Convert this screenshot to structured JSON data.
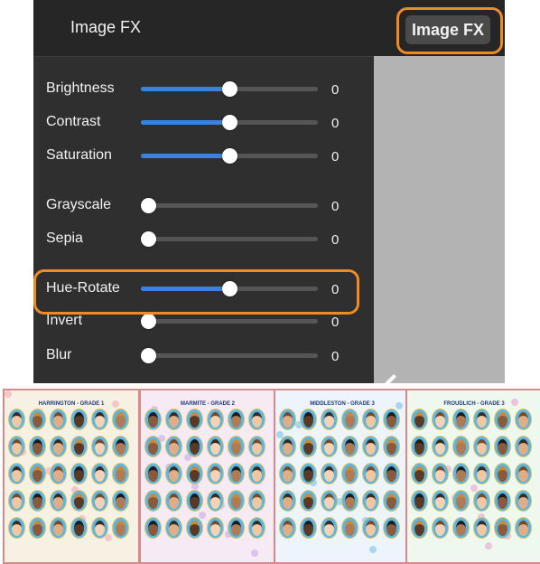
{
  "panel": {
    "title": "Image FX"
  },
  "toolbar": {
    "image_fx_button_label": "Image FX"
  },
  "sliders": [
    {
      "label": "Brightness",
      "value": "0",
      "level": 0.5
    },
    {
      "label": "Contrast",
      "value": "0",
      "level": 0.5
    },
    {
      "label": "Saturation",
      "value": "0",
      "level": 0.5
    },
    {
      "label": "Grayscale",
      "value": "0",
      "level": 0.0
    },
    {
      "label": "Sepia",
      "value": "0",
      "level": 0.0
    },
    {
      "label": "Hue-Rotate",
      "value": "0",
      "level": 0.5
    },
    {
      "label": "Invert",
      "value": "0",
      "level": 0.0
    },
    {
      "label": "Blur",
      "value": "0",
      "level": 0.0
    }
  ],
  "posters": [
    {
      "title": "HARRINGTON - GRADE 1",
      "bg": "#f7f1e3",
      "ring": "#58b7e6",
      "flower": "#f2a3b7"
    },
    {
      "title": "MARMITE - GRADE 2",
      "bg": "#f6ebf4",
      "ring": "#58b7e6",
      "flower": "#c6a2e8"
    },
    {
      "title": "MIDDLESTON - GRADE 3",
      "bg": "#eef4fb",
      "ring": "#58b7e6",
      "flower": "#6fbde8"
    },
    {
      "title": "FROUDLICH - GRADE 3",
      "bg": "#eff8ee",
      "ring": "#58b7e6",
      "flower": "#e59ad0"
    }
  ],
  "colors": {
    "accent_blue": "#3b82e0",
    "highlight_orange": "#f08a24",
    "panel_bg": "#2f2f2f"
  }
}
